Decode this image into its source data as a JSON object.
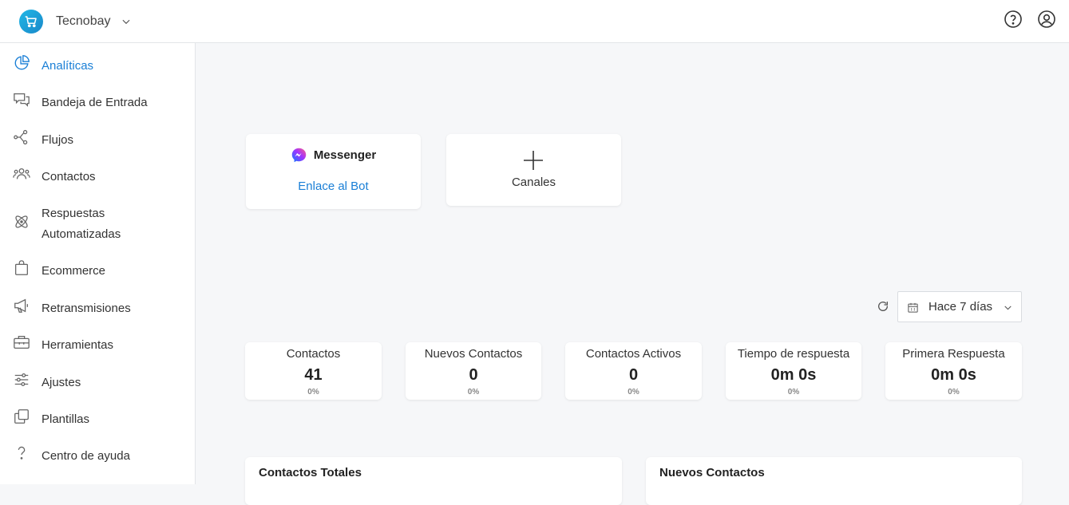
{
  "header": {
    "workspace_name": "Tecnobay",
    "help_icon": "help-circle-icon",
    "profile_icon": "user-circle-icon"
  },
  "sidebar": {
    "items": [
      {
        "label": "Analíticas",
        "icon": "pie-chart-icon",
        "active": true
      },
      {
        "label": "Bandeja de Entrada",
        "icon": "chat-bubbles-icon"
      },
      {
        "label": "Flujos",
        "icon": "flows-icon"
      },
      {
        "label": "Contactos",
        "icon": "people-icon"
      },
      {
        "label": "Respuestas",
        "label2": "Automatizadas",
        "icon": "atom-icon"
      },
      {
        "label": "Ecommerce",
        "icon": "shopping-bag-icon"
      },
      {
        "label": "Retransmisiones",
        "icon": "megaphone-icon"
      },
      {
        "label": "Herramientas",
        "icon": "toolbox-icon"
      },
      {
        "label": "Ajustes",
        "icon": "sliders-icon"
      },
      {
        "label": "Plantillas",
        "icon": "copy-icon"
      },
      {
        "label": "Centro de ayuda",
        "icon": "question-icon"
      }
    ]
  },
  "channels": {
    "messenger_title": "Messenger",
    "bot_link": "Enlace al Bot",
    "add_label": "Canales"
  },
  "filters": {
    "date_range": "Hace 7 días"
  },
  "stats": [
    {
      "label": "Contactos",
      "value": "41",
      "pct": "0%"
    },
    {
      "label": "Nuevos Contactos",
      "value": "0",
      "pct": "0%"
    },
    {
      "label": "Contactos Activos",
      "value": "0",
      "pct": "0%"
    },
    {
      "label": "Tiempo de respuesta",
      "value": "0m 0s",
      "pct": "0%"
    },
    {
      "label": "Primera Respuesta",
      "value": "0m 0s",
      "pct": "0%"
    }
  ],
  "charts": {
    "total_contacts_title": "Contactos Totales",
    "new_contacts_title": "Nuevos Contactos"
  },
  "colors": {
    "accent": "#1a7fd6",
    "brand": "#1fb7e6"
  }
}
